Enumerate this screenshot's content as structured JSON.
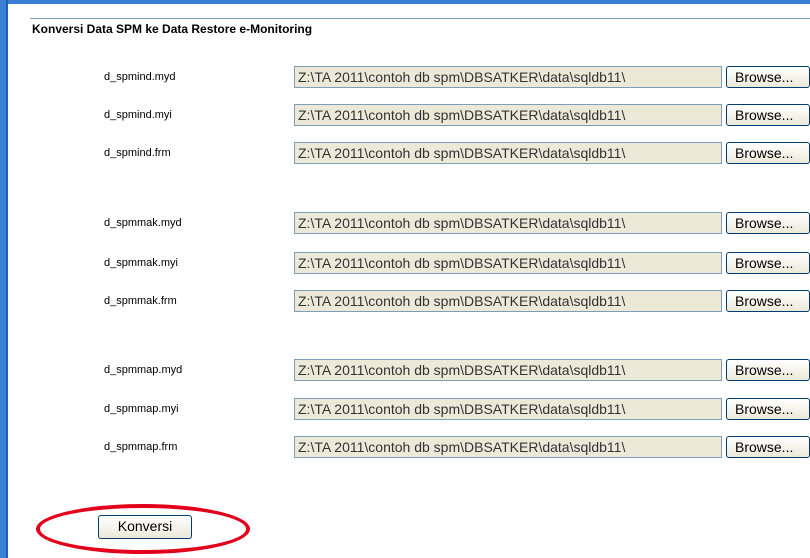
{
  "section_title": "Konversi Data SPM ke Data Restore e-Monitoring",
  "browse_label": "Browse...",
  "file_rows": [
    {
      "label": "d_spmind.myd",
      "value": "Z:\\TA 2011\\contoh db spm\\DBSATKER\\data\\sqldb11\\"
    },
    {
      "label": "d_spmind.myi",
      "value": "Z:\\TA 2011\\contoh db spm\\DBSATKER\\data\\sqldb11\\"
    },
    {
      "label": "d_spmind.frm",
      "value": "Z:\\TA 2011\\contoh db spm\\DBSATKER\\data\\sqldb11\\"
    },
    {
      "label": "d_spmmak.myd",
      "value": "Z:\\TA 2011\\contoh db spm\\DBSATKER\\data\\sqldb11\\"
    },
    {
      "label": "d_spmmak.myi",
      "value": "Z:\\TA 2011\\contoh db spm\\DBSATKER\\data\\sqldb11\\"
    },
    {
      "label": "d_spmmak.frm",
      "value": "Z:\\TA 2011\\contoh db spm\\DBSATKER\\data\\sqldb11\\"
    },
    {
      "label": "d_spmmap.myd",
      "value": "Z:\\TA 2011\\contoh db spm\\DBSATKER\\data\\sqldb11\\"
    },
    {
      "label": "d_spmmap.myi",
      "value": "Z:\\TA 2011\\contoh db spm\\DBSATKER\\data\\sqldb11\\"
    },
    {
      "label": "d_spmmap.frm",
      "value": "Z:\\TA 2011\\contoh db spm\\DBSATKER\\data\\sqldb11\\"
    }
  ],
  "convert_button": "Konversi",
  "highlight_color": "#e3001b"
}
